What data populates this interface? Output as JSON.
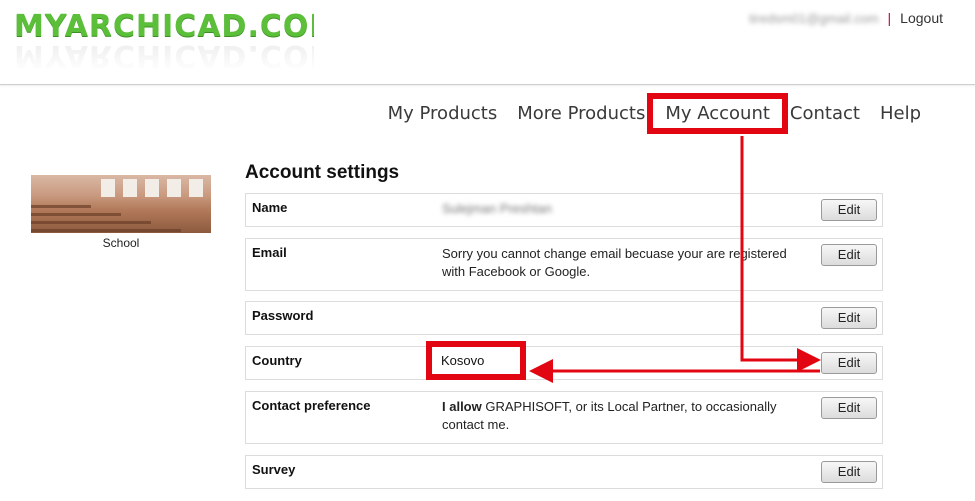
{
  "header": {
    "logo_text": "MYARCHICAD.COM",
    "user_email": "tiredsm01@gmail.com",
    "separator": "|",
    "logout_label": "Logout"
  },
  "nav": {
    "items": [
      {
        "label": "My Products"
      },
      {
        "label": "More Products"
      },
      {
        "label": "My Account"
      },
      {
        "label": "Contact"
      },
      {
        "label": "Help"
      }
    ]
  },
  "sidebar": {
    "caption": "School"
  },
  "settings": {
    "title": "Account settings",
    "edit_label": "Edit",
    "rows": [
      {
        "label": "Name",
        "value": "Sulejman Preshtan"
      },
      {
        "label": "Email",
        "value": "Sorry you cannot change email becuase your are registered with Facebook or Google."
      },
      {
        "label": "Password",
        "value": ""
      },
      {
        "label": "Country",
        "value": "Kosovo"
      },
      {
        "label": "Contact preference",
        "value_strong": "I allow",
        "value_rest": " GRAPHISOFT, or its Local Partner, to occasionally contact me."
      },
      {
        "label": "Survey",
        "value": ""
      }
    ]
  },
  "colors": {
    "logo_green": "#5bbf3a",
    "annotation_red": "#e10612",
    "separator_magenta": "#c0004a"
  }
}
